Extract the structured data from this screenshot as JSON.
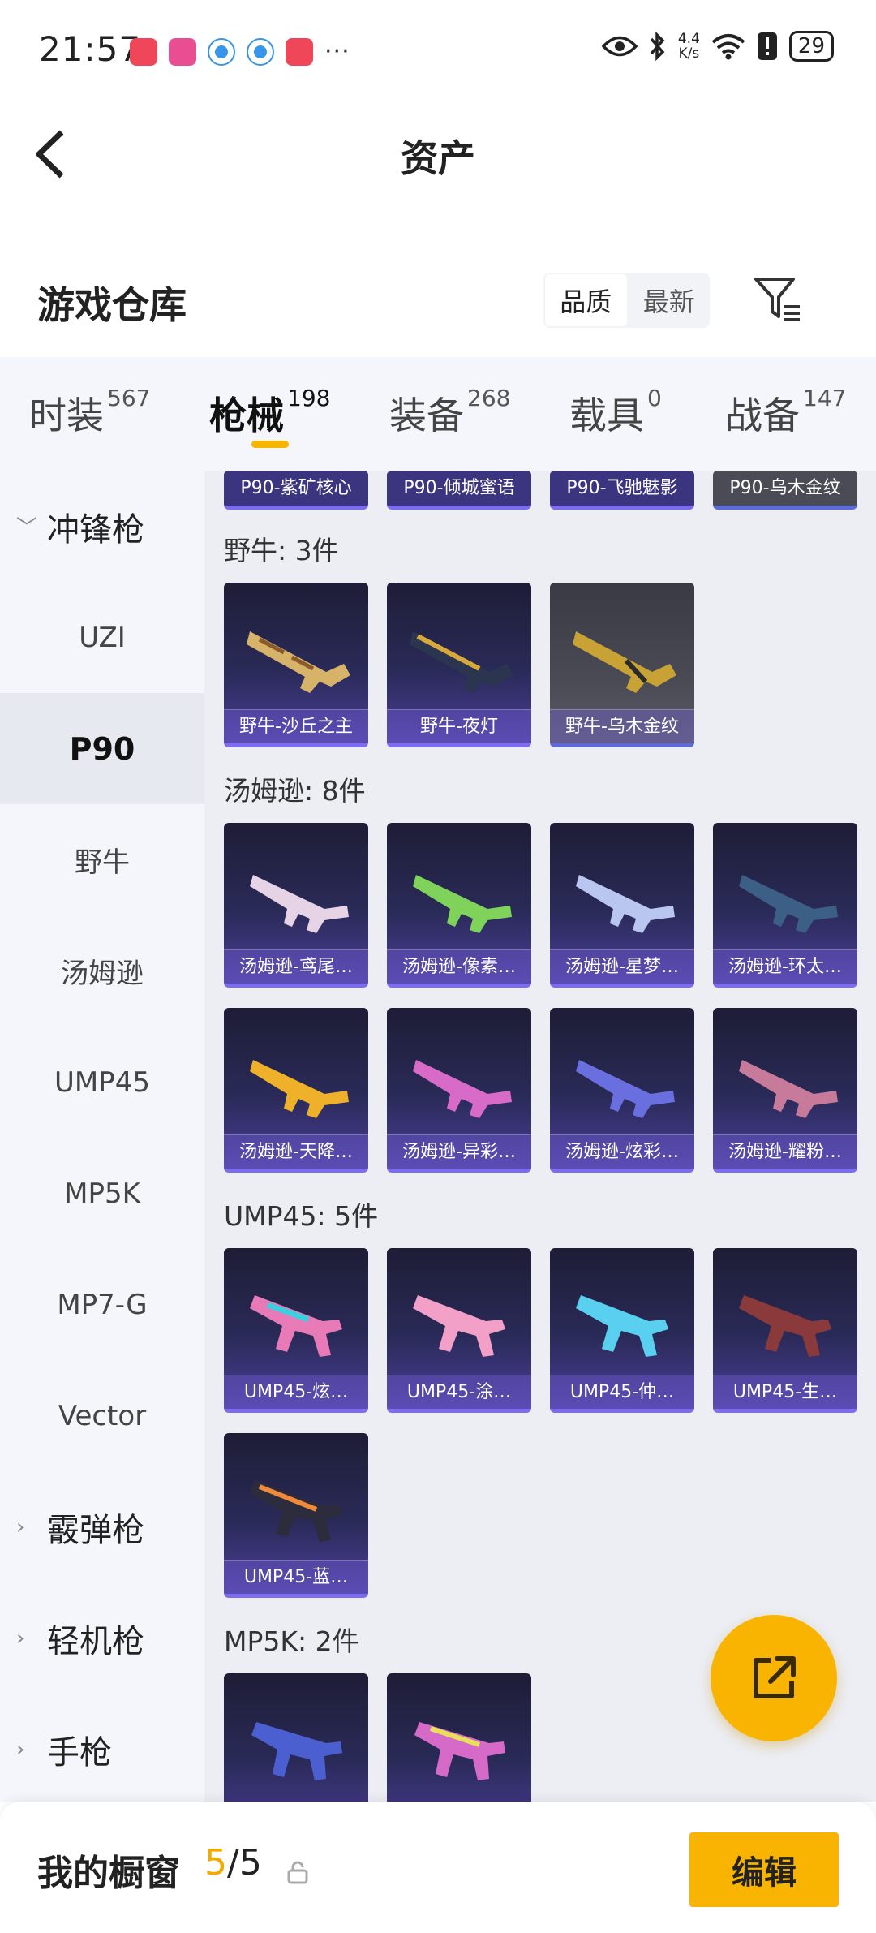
{
  "status_bar": {
    "time": "21:57",
    "more": "···",
    "net_speed_value": "4.4",
    "net_speed_unit": "K/s",
    "battery": "29"
  },
  "header": {
    "title": "资产"
  },
  "warehouse": {
    "title": "游戏仓库",
    "sort_options": [
      "品质",
      "最新"
    ],
    "sort_selected": "品质"
  },
  "category_tabs": [
    {
      "label": "时装",
      "count": "567"
    },
    {
      "label": "枪械",
      "count": "198",
      "active": true
    },
    {
      "label": "装备",
      "count": "268"
    },
    {
      "label": "载具",
      "count": "0"
    },
    {
      "label": "战备",
      "count": "147"
    }
  ],
  "sidebar": {
    "items": [
      {
        "label": "冲锋枪",
        "type": "group",
        "expanded": true
      },
      {
        "label": "UZI"
      },
      {
        "label": "P90",
        "active": true
      },
      {
        "label": "野牛"
      },
      {
        "label": "汤姆逊"
      },
      {
        "label": "UMP45"
      },
      {
        "label": "MP5K"
      },
      {
        "label": "MP7-G"
      },
      {
        "label": "Vector"
      },
      {
        "label": "霰弹枪",
        "type": "group"
      },
      {
        "label": "轻机枪",
        "type": "group"
      },
      {
        "label": "手枪",
        "type": "group"
      }
    ]
  },
  "sections": {
    "p90_tail": [
      "P90-紫矿核心",
      "P90-倾城蜜语",
      "P90-飞驰魅影",
      "P90-乌木金纹"
    ],
    "bison": {
      "title": "野牛: 3件",
      "items": [
        "野牛-沙丘之主",
        "野牛-夜灯",
        "野牛-乌木金纹"
      ]
    },
    "thompson": {
      "title": "汤姆逊: 8件",
      "items": [
        "汤姆逊-鸢尾…",
        "汤姆逊-像素…",
        "汤姆逊-星梦…",
        "汤姆逊-环太…",
        "汤姆逊-天降…",
        "汤姆逊-异彩…",
        "汤姆逊-炫彩…",
        "汤姆逊-耀粉…"
      ]
    },
    "ump45": {
      "title": "UMP45: 5件",
      "items": [
        "UMP45-炫…",
        "UMP45-涂…",
        "UMP45-仲…",
        "UMP45-生…",
        "UMP45-蓝…"
      ]
    },
    "mp5k": {
      "title": "MP5K: 2件"
    }
  },
  "bottom_bar": {
    "title": "我的橱窗",
    "current": "5",
    "separator": "/",
    "total": "5",
    "edit_label": "编辑"
  },
  "colors": {
    "accent": "#f8b400",
    "card_dark": "#2a2a58",
    "card_border": "#7b6cf0"
  }
}
